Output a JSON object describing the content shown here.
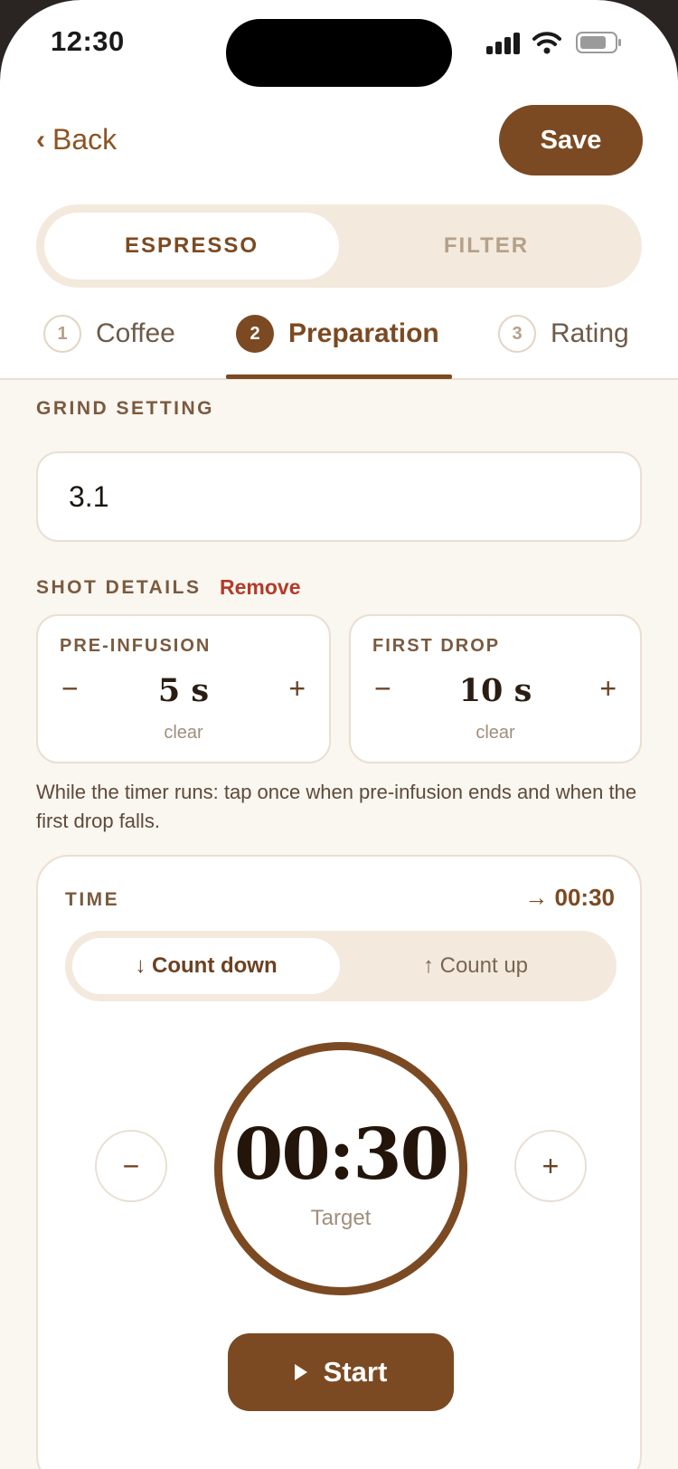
{
  "status_bar": {
    "time": "12:30",
    "icons": [
      "signal-icon",
      "wifi-icon",
      "battery-icon"
    ]
  },
  "header": {
    "back_label": "Back",
    "back_icon": "chevron-left-icon",
    "save_label": "Save"
  },
  "method_segment": {
    "options": [
      "ESPRESSO",
      "FILTER"
    ],
    "selected": "ESPRESSO"
  },
  "steps": [
    {
      "number": "1",
      "label": "Coffee"
    },
    {
      "number": "2",
      "label": "Preparation"
    },
    {
      "number": "3",
      "label": "Rating"
    }
  ],
  "active_step": "Preparation",
  "grind": {
    "label": "GRIND SETTING",
    "value": "3.1"
  },
  "shot_details": {
    "label": "SHOT DETAILS",
    "remove_label": "Remove",
    "pre_infusion": {
      "title": "PRE-INFUSION",
      "value": "5 s",
      "clear_label": "clear",
      "minus": "−",
      "plus": "+"
    },
    "first_drop": {
      "title": "FIRST DROP",
      "value": "10 s",
      "clear_label": "clear",
      "minus": "−",
      "plus": "+"
    },
    "hint": "While the timer runs: tap once when pre-infusion ends and when the first drop falls."
  },
  "timer": {
    "label": "TIME",
    "target_display": "→ 00:30",
    "modes": [
      "↓ Count down",
      "↑ Count up"
    ],
    "selected_mode": "↓ Count down",
    "decrement": "−",
    "increment": "+",
    "display": "00:30",
    "sublabel": "Target",
    "start_label": "Start"
  },
  "colors": {
    "accent": "#7b4a22",
    "background": "#faf6f0",
    "danger": "#b43a2a"
  }
}
